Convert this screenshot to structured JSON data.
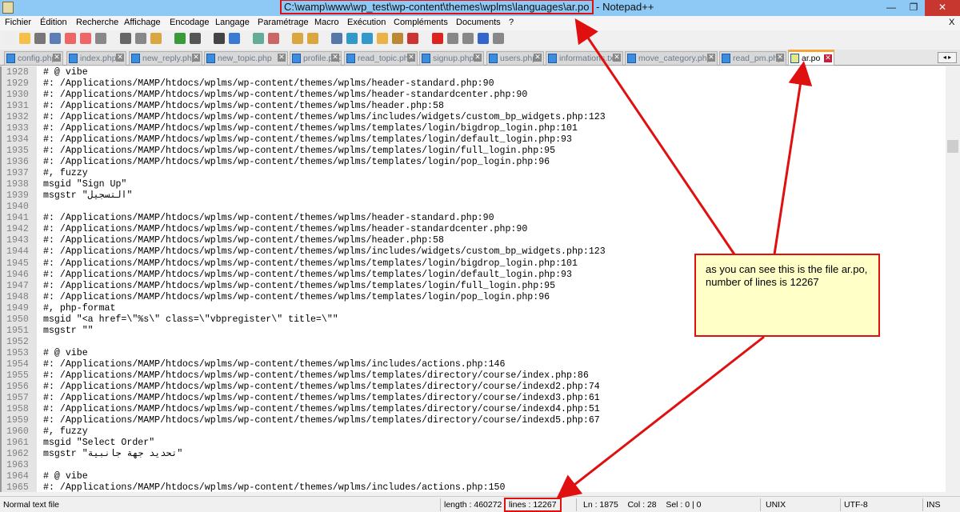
{
  "window": {
    "title_path": "C:\\wamp\\www\\wp_test\\wp-content\\themes\\wplms\\languages\\ar.po",
    "title_sep": " - ",
    "app_name": "Notepad++",
    "minimize": "—",
    "maximize": "❐",
    "close": "✕",
    "menu_close": "X"
  },
  "menu": [
    "Fichier",
    "Édition",
    "Recherche",
    "Affichage",
    "Encodage",
    "Langage",
    "Paramétrage",
    "Macro",
    "Exécution",
    "Compléments",
    "Documents",
    "?"
  ],
  "tabs": [
    {
      "label": "config.php",
      "active": false
    },
    {
      "label": "index.php",
      "active": false
    },
    {
      "label": "new_reply.php",
      "active": false
    },
    {
      "label": "new_topic.php",
      "active": false
    },
    {
      "label": "profile.php",
      "active": false
    },
    {
      "label": "read_topic.php",
      "active": false
    },
    {
      "label": "signup.php",
      "active": false
    },
    {
      "label": "users.php",
      "active": false
    },
    {
      "label": "informations.txt",
      "active": false
    },
    {
      "label": "move_category.php",
      "active": false
    },
    {
      "label": "read_pm.php",
      "active": false
    },
    {
      "label": "ar.po",
      "active": true
    }
  ],
  "lines": [
    [
      "1928",
      "# @ vibe"
    ],
    [
      "1929",
      "#: /Applications/MAMP/htdocs/wplms/wp-content/themes/wplms/header-standard.php:90"
    ],
    [
      "1930",
      "#: /Applications/MAMP/htdocs/wplms/wp-content/themes/wplms/header-standardcenter.php:90"
    ],
    [
      "1931",
      "#: /Applications/MAMP/htdocs/wplms/wp-content/themes/wplms/header.php:58"
    ],
    [
      "1932",
      "#: /Applications/MAMP/htdocs/wplms/wp-content/themes/wplms/includes/widgets/custom_bp_widgets.php:123"
    ],
    [
      "1933",
      "#: /Applications/MAMP/htdocs/wplms/wp-content/themes/wplms/templates/login/bigdrop_login.php:101"
    ],
    [
      "1934",
      "#: /Applications/MAMP/htdocs/wplms/wp-content/themes/wplms/templates/login/default_login.php:93"
    ],
    [
      "1935",
      "#: /Applications/MAMP/htdocs/wplms/wp-content/themes/wplms/templates/login/full_login.php:95"
    ],
    [
      "1936",
      "#: /Applications/MAMP/htdocs/wplms/wp-content/themes/wplms/templates/login/pop_login.php:96"
    ],
    [
      "1937",
      "#, fuzzy"
    ],
    [
      "1938",
      "msgid \"Sign Up\""
    ],
    [
      "1939",
      "msgstr \"‪التسجيل‬\""
    ],
    [
      "1940",
      ""
    ],
    [
      "1941",
      "#: /Applications/MAMP/htdocs/wplms/wp-content/themes/wplms/header-standard.php:90"
    ],
    [
      "1942",
      "#: /Applications/MAMP/htdocs/wplms/wp-content/themes/wplms/header-standardcenter.php:90"
    ],
    [
      "1943",
      "#: /Applications/MAMP/htdocs/wplms/wp-content/themes/wplms/header.php:58"
    ],
    [
      "1944",
      "#: /Applications/MAMP/htdocs/wplms/wp-content/themes/wplms/includes/widgets/custom_bp_widgets.php:123"
    ],
    [
      "1945",
      "#: /Applications/MAMP/htdocs/wplms/wp-content/themes/wplms/templates/login/bigdrop_login.php:101"
    ],
    [
      "1946",
      "#: /Applications/MAMP/htdocs/wplms/wp-content/themes/wplms/templates/login/default_login.php:93"
    ],
    [
      "1947",
      "#: /Applications/MAMP/htdocs/wplms/wp-content/themes/wplms/templates/login/full_login.php:95"
    ],
    [
      "1948",
      "#: /Applications/MAMP/htdocs/wplms/wp-content/themes/wplms/templates/login/pop_login.php:96"
    ],
    [
      "1949",
      "#, php-format"
    ],
    [
      "1950",
      "msgid \"<a href=\\\"%s\\\" class=\\\"vbpregister\\\" title=\\\"\""
    ],
    [
      "1951",
      "msgstr \"\""
    ],
    [
      "1952",
      ""
    ],
    [
      "1953",
      "# @ vibe"
    ],
    [
      "1954",
      "#: /Applications/MAMP/htdocs/wplms/wp-content/themes/wplms/includes/actions.php:146"
    ],
    [
      "1955",
      "#: /Applications/MAMP/htdocs/wplms/wp-content/themes/wplms/templates/directory/course/index.php:86"
    ],
    [
      "1956",
      "#: /Applications/MAMP/htdocs/wplms/wp-content/themes/wplms/templates/directory/course/indexd2.php:74"
    ],
    [
      "1957",
      "#: /Applications/MAMP/htdocs/wplms/wp-content/themes/wplms/templates/directory/course/indexd3.php:61"
    ],
    [
      "1958",
      "#: /Applications/MAMP/htdocs/wplms/wp-content/themes/wplms/templates/directory/course/indexd4.php:51"
    ],
    [
      "1959",
      "#: /Applications/MAMP/htdocs/wplms/wp-content/themes/wplms/templates/directory/course/indexd5.php:67"
    ],
    [
      "1960",
      "#, fuzzy"
    ],
    [
      "1961",
      "msgid \"Select Order\""
    ],
    [
      "1962",
      "msgstr \"‪تحديد جهة جانبية‬\""
    ],
    [
      "1963",
      ""
    ],
    [
      "1964",
      "# @ vibe"
    ],
    [
      "1965",
      "#: /Applications/MAMP/htdocs/wplms/wp-content/themes/wplms/includes/actions.php:150"
    ]
  ],
  "status": {
    "file_type": "Normal text file",
    "length": "length : 460272",
    "lines": "lines : 12267",
    "position": "Ln : 1875    Col : 28    Sel : 0 | 0",
    "eol": "UNIX",
    "encoding": "UTF-8",
    "mode": "INS"
  },
  "annotation": {
    "text": "as you can see this is the file ar.po, number of lines is 12267",
    "color": "#e01010",
    "background": "#ffffc8"
  },
  "colors": {
    "titlebar": "#8ec8f5",
    "active_tab_accent": "#f6a33a",
    "gutter": "#e4e4e4"
  }
}
